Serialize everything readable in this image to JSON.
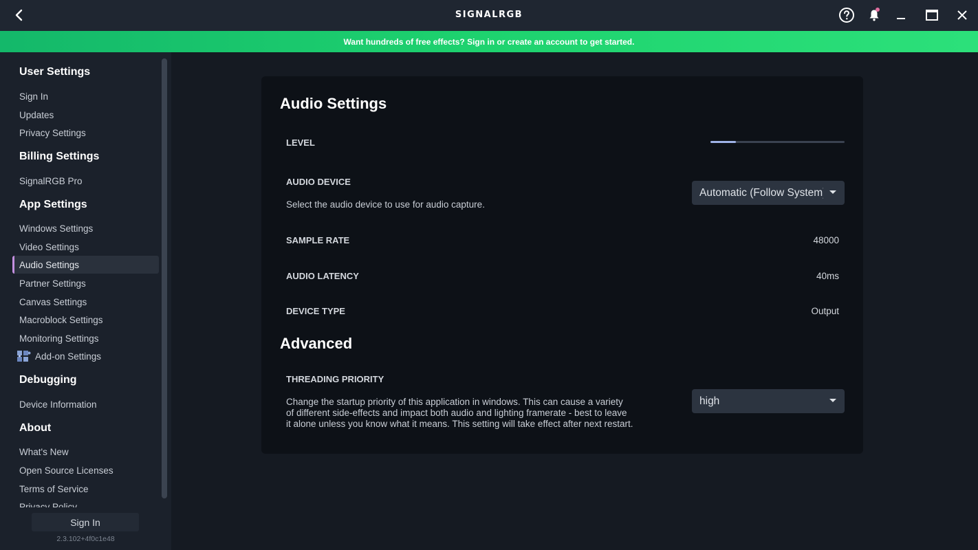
{
  "app": {
    "title": "SIGNALRGB"
  },
  "banner": {
    "text": "Want hundreds of free effects? Sign in or create an account to get started."
  },
  "sidebar": {
    "sections": [
      {
        "heading": "User Settings",
        "items": [
          "Sign In",
          "Updates",
          "Privacy Settings"
        ]
      },
      {
        "heading": "Billing Settings",
        "items": [
          "SignalRGB Pro"
        ]
      },
      {
        "heading": "App Settings",
        "items": [
          "Windows Settings",
          "Video Settings",
          "Audio Settings",
          "Partner Settings",
          "Canvas Settings",
          "Macroblock Settings",
          "Monitoring Settings",
          "Add-on Settings"
        ]
      },
      {
        "heading": "Debugging",
        "items": [
          "Device Information"
        ]
      },
      {
        "heading": "About",
        "items": [
          "What's New",
          "Open Source Licenses",
          "Terms of Service",
          "Privacy Policy"
        ]
      }
    ],
    "active_item": "Audio Settings",
    "sign_in_button": "Sign In",
    "version": "2.3.102+4f0c1e48"
  },
  "audio": {
    "title": "Audio Settings",
    "level": {
      "label": "LEVEL",
      "value_fraction": 0.19
    },
    "device": {
      "label": "AUDIO DEVICE",
      "description": "Select the audio device to use for audio capture.",
      "selected": "Automatic (Follow System)"
    },
    "sample_rate": {
      "label": "SAMPLE RATE",
      "value": "48000"
    },
    "latency": {
      "label": "AUDIO LATENCY",
      "value": "40ms"
    },
    "device_type": {
      "label": "DEVICE TYPE",
      "value": "Output"
    }
  },
  "advanced": {
    "title": "Advanced",
    "threading": {
      "label": "THREADING PRIORITY",
      "description_lines": [
        "Change the startup priority of this application in windows.  This can cause a variety",
        "of different side-effects and impact both audio and lighting framerate - best to leave",
        "it alone unless you know what it means.  This setting will take effect after next restart."
      ],
      "selected": "high"
    }
  },
  "colors": {
    "accent_purple": "#c48fe0",
    "banner_green": "#1ed36f",
    "notification_dot": "#e06fa0"
  }
}
